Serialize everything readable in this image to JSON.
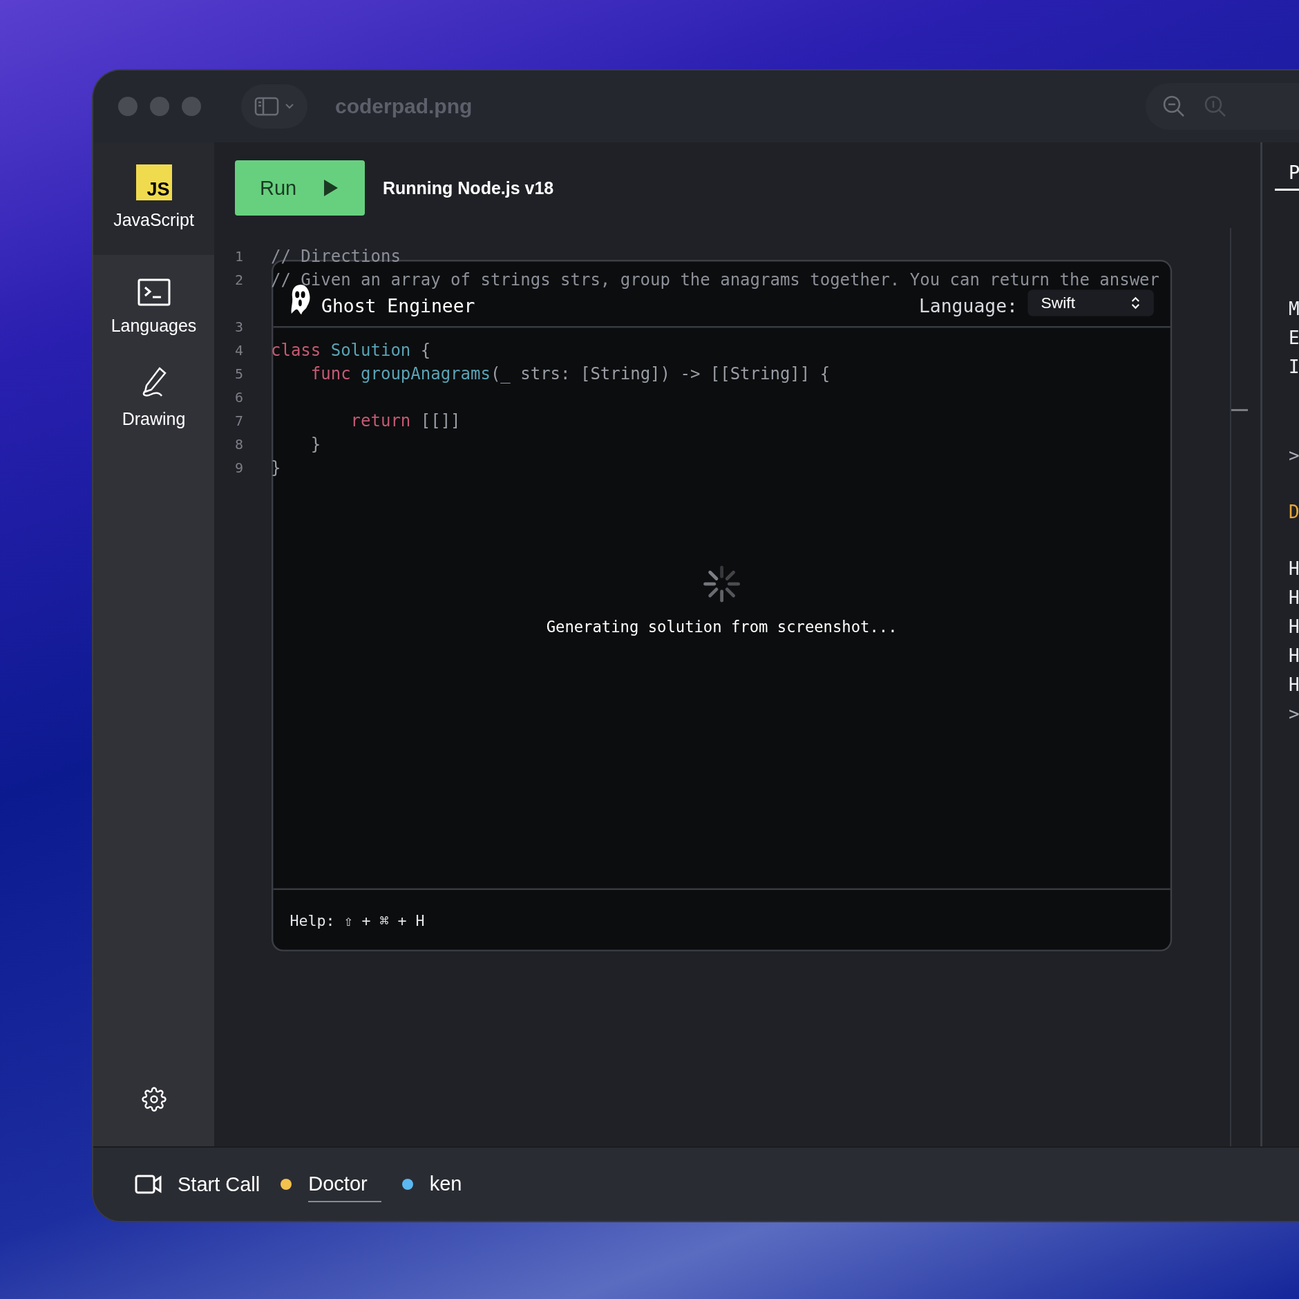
{
  "window": {
    "title": "coderpad.png"
  },
  "sidebar": {
    "items": [
      {
        "label": "JavaScript",
        "kind": "language",
        "badge": "JS"
      },
      {
        "label": "Languages",
        "kind": "terminal"
      },
      {
        "label": "Drawing",
        "kind": "drawing"
      }
    ]
  },
  "toolbar": {
    "run_label": "Run",
    "runtime": "Running Node.js v18"
  },
  "editor": {
    "lines": [
      {
        "number": "1",
        "tokens": [
          {
            "text": "// Directions",
            "kind": "comment"
          }
        ]
      },
      {
        "number": "2",
        "tokens": [
          {
            "text": "// Given an array of strings strs, group the anagrams together. You can return the answer",
            "kind": "comment"
          }
        ],
        "wrapped": true
      },
      {
        "number": "3"
      },
      {
        "number": "4",
        "tokens": [
          {
            "text": "class",
            "kind": "keyword"
          },
          {
            "text": " Solution",
            "kind": "type"
          },
          {
            "text": " {",
            "kind": "plain"
          }
        ]
      },
      {
        "number": "5",
        "tokens": [
          {
            "text": "    func",
            "kind": "keyword"
          },
          {
            "text": " groupAnagrams",
            "kind": "type"
          },
          {
            "text": "(_ strs: [String]) -> [[String]] {",
            "kind": "plain"
          }
        ]
      },
      {
        "number": "6"
      },
      {
        "number": "7",
        "tokens": [
          {
            "text": "        return",
            "kind": "keyword"
          },
          {
            "text": " [[]]",
            "kind": "plain"
          }
        ]
      },
      {
        "number": "8",
        "tokens": [
          {
            "text": "    }",
            "kind": "plain"
          }
        ]
      },
      {
        "number": "9",
        "tokens": [
          {
            "text": "}",
            "kind": "plain"
          }
        ]
      }
    ]
  },
  "overlay": {
    "title": "Ghost Engineer",
    "language_label": "Language:",
    "language": "Swift",
    "status": "Generating solution from screenshot...",
    "help": "Help: ⇧ + ⌘ + H"
  },
  "right_panel": {
    "tab": "P",
    "lines": [
      {
        "text": "M",
        "kind": "text"
      },
      {
        "text": "E",
        "kind": "text"
      },
      {
        "text": "I",
        "kind": "text"
      },
      {
        "text": ">",
        "kind": "prompt"
      },
      {
        "text": "D",
        "kind": "warning"
      },
      {
        "text": "H",
        "kind": "text"
      },
      {
        "text": "H",
        "kind": "text"
      },
      {
        "text": "H",
        "kind": "text"
      },
      {
        "text": "H",
        "kind": "text"
      },
      {
        "text": "H",
        "kind": "text"
      },
      {
        "text": ">",
        "kind": "prompt"
      }
    ]
  },
  "call_bar": {
    "start_call": "Start Call",
    "participants": [
      {
        "name": "Doctor",
        "color": "#f2c14e",
        "selected": true
      },
      {
        "name": "ken",
        "color": "#5bb8f0",
        "selected": false
      }
    ]
  }
}
